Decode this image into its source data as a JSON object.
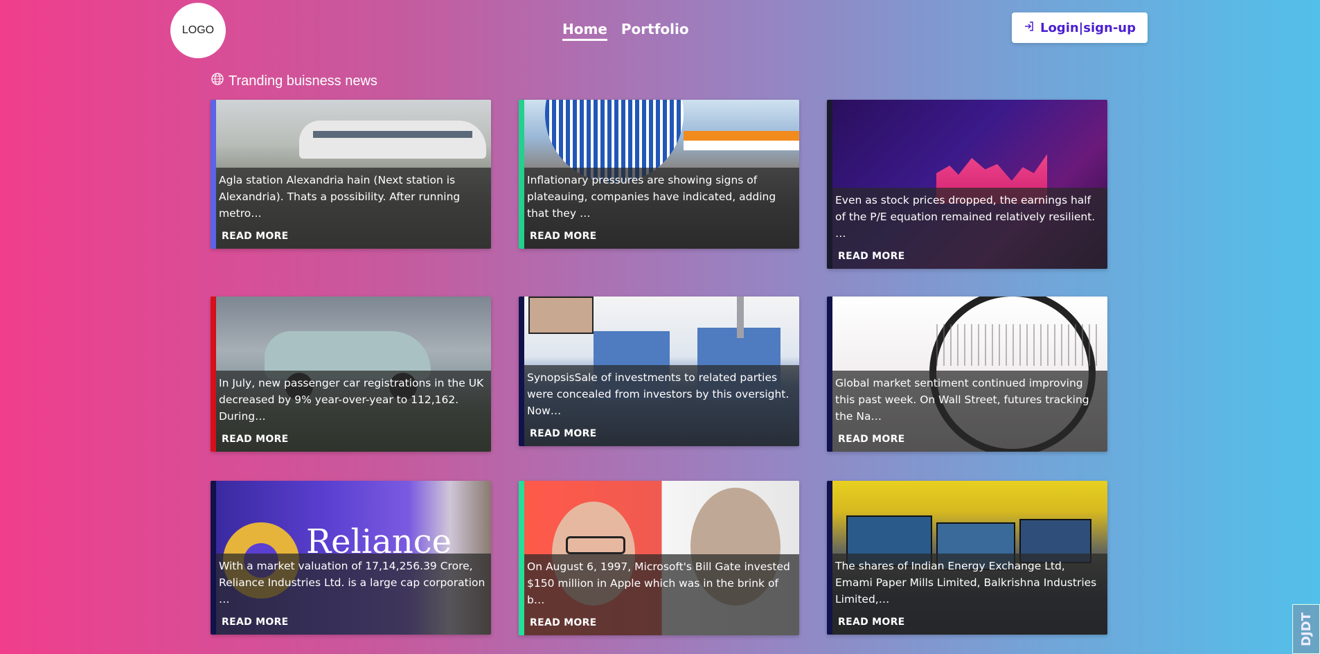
{
  "header": {
    "logo": "LOGO",
    "nav": [
      {
        "label": "Home",
        "active": true
      },
      {
        "label": "Portfolio",
        "active": false
      }
    ],
    "login_label": "Login|sign-up",
    "login_icon": "sign-in-icon"
  },
  "section": {
    "icon": "globe-icon",
    "title": "Tranding buisness news"
  },
  "cards": [
    {
      "text": "Agla station Alexandria hain (Next station is Alexandria). Thats a possibility. After running metro…",
      "read_more": "READ MORE",
      "stripe": "#5b63e6",
      "image": "metro-train-image"
    },
    {
      "text": "Inflationary pressures are showing signs of plateauing, companies have indicated, adding that they …",
      "read_more": "READ MORE",
      "stripe": "#22d18b",
      "image": "globe-india-flag-image"
    },
    {
      "text": "Even as stock prices dropped, the earnings half of the P/E equation remained relatively resilient. …",
      "read_more": "READ MORE",
      "stripe": "#1a1a2e",
      "image": "stock-board-image"
    },
    {
      "text": "In July, new passenger car registrations in the UK decreased by 9% year-over-year to 112,162. During…",
      "read_more": "READ MORE",
      "stripe": "#d4101a",
      "image": "car-image"
    },
    {
      "text": "SynopsisSale of investments to related parties were concealed from investors by this oversight. Now…",
      "read_more": "READ MORE",
      "stripe": "#12124a",
      "image": "power-plant-image"
    },
    {
      "text": "Global market sentiment continued improving this past week. On Wall Street, futures tracking the Na…",
      "read_more": "READ MORE",
      "stripe": "#12124a",
      "image": "magnifier-chart-image"
    },
    {
      "text": "With a market valuation of 17,14,256.39 Crore, Reliance Industries Ltd. is a large cap corporation …",
      "read_more": "READ MORE",
      "stripe": "#12124a",
      "image": "reliance-image"
    },
    {
      "text": "On August 6, 1997, Microsoft's Bill Gate invested $150 million in Apple which was in the brink of b…",
      "read_more": "READ MORE",
      "stripe": "#22e09a",
      "image": "gates-jobs-image"
    },
    {
      "text": "The shares of Indian Energy Exchange Ltd, Emami Paper Mills Limited, Balkrishna Industries Limited,…",
      "read_more": "READ MORE",
      "stripe": "#12124a",
      "image": "trading-floor-image"
    }
  ],
  "badge": "DJDT"
}
